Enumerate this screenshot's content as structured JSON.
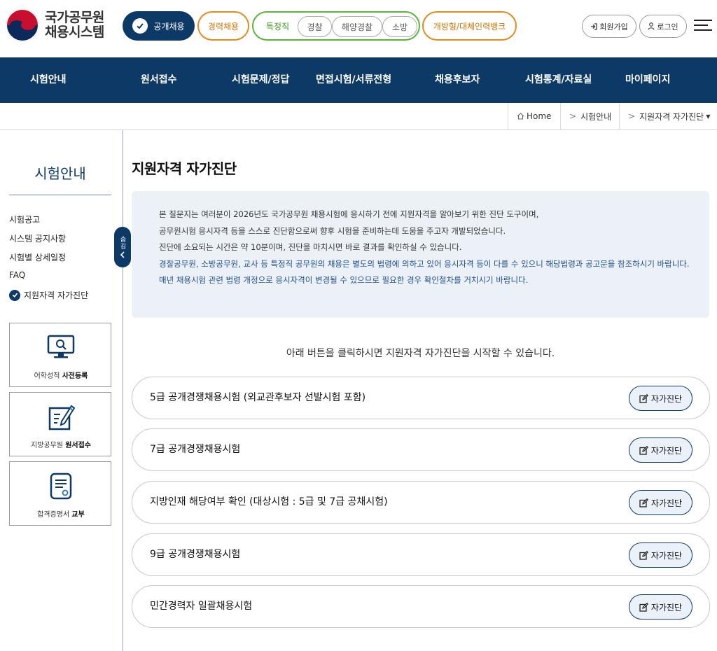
{
  "logo": {
    "line1": "국가공무원",
    "line2": "채용시스템"
  },
  "categories": {
    "public": "공개채용",
    "career": "경력채용",
    "special": "특정직",
    "special_items": [
      "경찰",
      "해양경찰",
      "소방"
    ],
    "open": "개방형/대체인력뱅크"
  },
  "header_buttons": {
    "signup": "회원가입",
    "login": "로그인"
  },
  "nav": [
    "시험안내",
    "원서접수",
    "시험문제/정답",
    "면접시험/서류전형",
    "채용후보자",
    "시험통계/자료실",
    "마이페이지"
  ],
  "breadcrumb": {
    "home": "Home",
    "level1": "시험안내",
    "level2": "지원자격 자가진단"
  },
  "sidebar": {
    "title": "시험안내",
    "links": [
      "시험공고",
      "시스템 공지사항",
      "시험별 상세일정",
      "FAQ"
    ],
    "active_link": "지원자격 자가진단",
    "toggle_label": "숨김",
    "boxes": [
      {
        "prefix": "어학성적 ",
        "bold": "사전등록",
        "icon": "monitor-search-icon"
      },
      {
        "prefix": "지방공무원 ",
        "bold": "원서접수",
        "icon": "pen-document-icon"
      },
      {
        "prefix": "합격증명서 ",
        "bold": "교부",
        "icon": "certificate-icon"
      }
    ]
  },
  "main": {
    "title": "지원자격 자가진단",
    "notice": [
      "본 질문지는 여러분이 2026년도 국가공무원 채용시험에 응시하기 전에 지원자격을 알아보기 위한 진단 도구이며,",
      "공무원시험 응시자격 등을 스스로 진단함으로써 향후 시험을 준비하는데 도움을 주고자 개발되었습니다.",
      "진단에 소요되는 시간은 약 10분이며, 진단을 마치시면 바로 결과를 확인하실 수 있습니다.",
      "경찰공무원, 소방공무원, 교사 등 특정직 공무원의 채용은 별도의 법령에 의하고 있어 응시자격 등이 다를 수 있으니 해당법령과 공고문을 참조하시기 바랍니다.",
      "매년 채용시험 관련 법령 개정으로 응시자격이 변경될 수 있으므로 필요한 경우 확인절차를 거치시기 바랍니다."
    ],
    "intro": "아래 버튼을 클릭하시면 지원자격 자가진단을 시작할 수 있습니다.",
    "button_label": "자가진단",
    "exams": [
      "5급 공개경쟁채용시험 (외교관후보자 선발시험 포함)",
      "7급 공개경쟁채용시험",
      "지방인재 해당여부 확인 (대상시험 : 5급 및 7급 공채시험)",
      "9급 공개경쟁채용시험",
      "민간경력자 일괄채용시험"
    ]
  }
}
